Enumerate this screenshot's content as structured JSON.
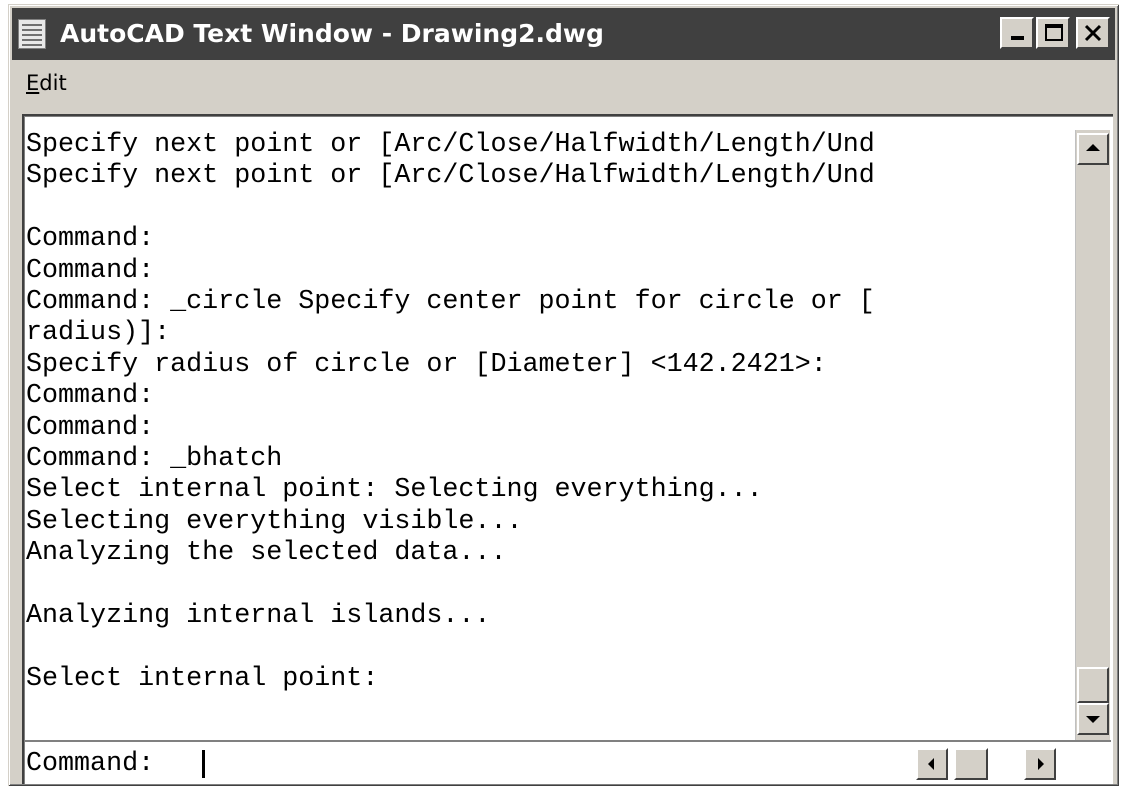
{
  "window": {
    "title": "AutoCAD Text Window - Drawing2.dwg",
    "app_icon": "autocad-text-window-icon",
    "title_bar_color": "#404040",
    "chrome_color": "#d4d0c8"
  },
  "title_buttons": {
    "minimize_icon": "minimize-icon",
    "maximize_icon": "maximize-icon",
    "close_icon": "close-icon"
  },
  "menu": {
    "edit_access_key": "E",
    "edit_rest": "dit"
  },
  "history": [
    "Specify next point or [Arc/Close/Halfwidth/Length/Und",
    "Specify next point or [Arc/Close/Halfwidth/Length/Und",
    "",
    "Command:",
    "Command:",
    "Command: _circle Specify center point for circle or [",
    "radius)]:",
    "Specify radius of circle or [Diameter] <142.2421>:",
    "Command:",
    "Command:",
    "Command: _bhatch",
    "Select internal point: Selecting everything...",
    "Selecting everything visible...",
    "Analyzing the selected data...",
    "",
    "Analyzing internal islands...",
    "",
    "Select internal point:"
  ],
  "prompt": {
    "label": "Command:",
    "value": ""
  },
  "scrollbars": {
    "up_icon": "scroll-up-arrow-icon",
    "down_icon": "scroll-down-arrow-icon",
    "left_icon": "scroll-left-arrow-icon",
    "right_icon": "scroll-right-arrow-icon"
  }
}
